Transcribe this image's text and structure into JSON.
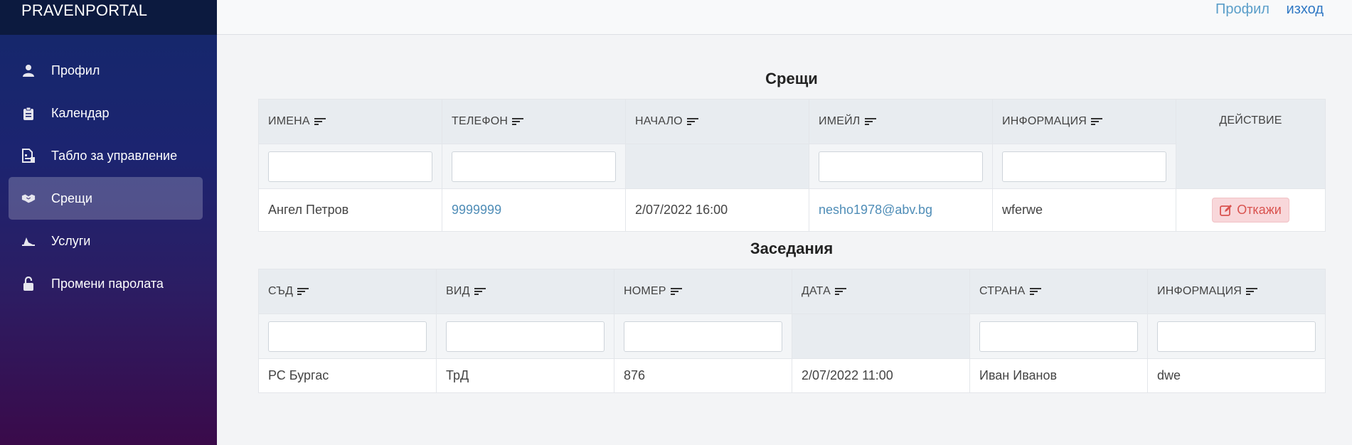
{
  "brand": "PRAVENPORTAL",
  "sidebar": {
    "items": [
      {
        "label": "Профил",
        "icon": "user-icon"
      },
      {
        "label": "Календар",
        "icon": "clipboard-icon"
      },
      {
        "label": "Табло за управление",
        "icon": "dashboard-icon"
      },
      {
        "label": "Срещи",
        "icon": "handshake-icon",
        "active": true
      },
      {
        "label": "Услуги",
        "icon": "services-icon"
      },
      {
        "label": "Промени паролата",
        "icon": "unlock-icon"
      }
    ]
  },
  "topbar": {
    "profile_link": "Профил",
    "exit_link": "изход"
  },
  "meetings": {
    "title": "Срещи",
    "columns": [
      "ИМЕНА",
      "ТЕЛЕФОН",
      "НАЧАЛО",
      "ИМЕЙЛ",
      "ИНФОРМАЦИЯ",
      "ДЕЙСТВИЕ"
    ],
    "rows": [
      {
        "name": "Ангел Петров",
        "phone": "9999999",
        "start": "2/07/2022 16:00",
        "email": "nesho1978@abv.bg",
        "info": "wferwe",
        "action": "Откажи"
      }
    ]
  },
  "sessions": {
    "title": "Заседания",
    "columns": [
      "СЪД",
      "ВИД",
      "НОМЕР",
      "ДАТА",
      "СТРАНА",
      "ИНФОРМАЦИЯ"
    ],
    "rows": [
      {
        "court": "РС Бургас",
        "type": "ТрД",
        "number": "876",
        "date": "2/07/2022 11:00",
        "party": "Иван Иванов",
        "info": "dwe"
      }
    ]
  },
  "colors": {
    "sidebar_top": "#14286b",
    "sidebar_bottom": "#3a0a4a",
    "link": "#4f8db7",
    "decline_bg": "#f8d7da",
    "decline_text": "#d9534f"
  }
}
